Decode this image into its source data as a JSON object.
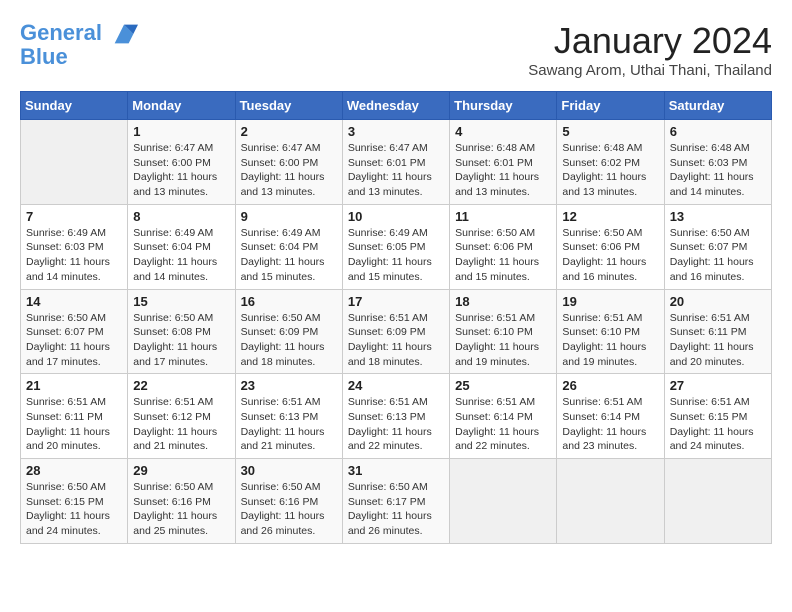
{
  "logo": {
    "line1": "General",
    "line2": "Blue"
  },
  "title": "January 2024",
  "subtitle": "Sawang Arom, Uthai Thani, Thailand",
  "days_of_week": [
    "Sunday",
    "Monday",
    "Tuesday",
    "Wednesday",
    "Thursday",
    "Friday",
    "Saturday"
  ],
  "weeks": [
    [
      {
        "day": "",
        "info": ""
      },
      {
        "day": "1",
        "info": "Sunrise: 6:47 AM\nSunset: 6:00 PM\nDaylight: 11 hours\nand 13 minutes."
      },
      {
        "day": "2",
        "info": "Sunrise: 6:47 AM\nSunset: 6:00 PM\nDaylight: 11 hours\nand 13 minutes."
      },
      {
        "day": "3",
        "info": "Sunrise: 6:47 AM\nSunset: 6:01 PM\nDaylight: 11 hours\nand 13 minutes."
      },
      {
        "day": "4",
        "info": "Sunrise: 6:48 AM\nSunset: 6:01 PM\nDaylight: 11 hours\nand 13 minutes."
      },
      {
        "day": "5",
        "info": "Sunrise: 6:48 AM\nSunset: 6:02 PM\nDaylight: 11 hours\nand 13 minutes."
      },
      {
        "day": "6",
        "info": "Sunrise: 6:48 AM\nSunset: 6:03 PM\nDaylight: 11 hours\nand 14 minutes."
      }
    ],
    [
      {
        "day": "7",
        "info": "Sunrise: 6:49 AM\nSunset: 6:03 PM\nDaylight: 11 hours\nand 14 minutes."
      },
      {
        "day": "8",
        "info": "Sunrise: 6:49 AM\nSunset: 6:04 PM\nDaylight: 11 hours\nand 14 minutes."
      },
      {
        "day": "9",
        "info": "Sunrise: 6:49 AM\nSunset: 6:04 PM\nDaylight: 11 hours\nand 15 minutes."
      },
      {
        "day": "10",
        "info": "Sunrise: 6:49 AM\nSunset: 6:05 PM\nDaylight: 11 hours\nand 15 minutes."
      },
      {
        "day": "11",
        "info": "Sunrise: 6:50 AM\nSunset: 6:06 PM\nDaylight: 11 hours\nand 15 minutes."
      },
      {
        "day": "12",
        "info": "Sunrise: 6:50 AM\nSunset: 6:06 PM\nDaylight: 11 hours\nand 16 minutes."
      },
      {
        "day": "13",
        "info": "Sunrise: 6:50 AM\nSunset: 6:07 PM\nDaylight: 11 hours\nand 16 minutes."
      }
    ],
    [
      {
        "day": "14",
        "info": "Sunrise: 6:50 AM\nSunset: 6:07 PM\nDaylight: 11 hours\nand 17 minutes."
      },
      {
        "day": "15",
        "info": "Sunrise: 6:50 AM\nSunset: 6:08 PM\nDaylight: 11 hours\nand 17 minutes."
      },
      {
        "day": "16",
        "info": "Sunrise: 6:50 AM\nSunset: 6:09 PM\nDaylight: 11 hours\nand 18 minutes."
      },
      {
        "day": "17",
        "info": "Sunrise: 6:51 AM\nSunset: 6:09 PM\nDaylight: 11 hours\nand 18 minutes."
      },
      {
        "day": "18",
        "info": "Sunrise: 6:51 AM\nSunset: 6:10 PM\nDaylight: 11 hours\nand 19 minutes."
      },
      {
        "day": "19",
        "info": "Sunrise: 6:51 AM\nSunset: 6:10 PM\nDaylight: 11 hours\nand 19 minutes."
      },
      {
        "day": "20",
        "info": "Sunrise: 6:51 AM\nSunset: 6:11 PM\nDaylight: 11 hours\nand 20 minutes."
      }
    ],
    [
      {
        "day": "21",
        "info": "Sunrise: 6:51 AM\nSunset: 6:11 PM\nDaylight: 11 hours\nand 20 minutes."
      },
      {
        "day": "22",
        "info": "Sunrise: 6:51 AM\nSunset: 6:12 PM\nDaylight: 11 hours\nand 21 minutes."
      },
      {
        "day": "23",
        "info": "Sunrise: 6:51 AM\nSunset: 6:13 PM\nDaylight: 11 hours\nand 21 minutes."
      },
      {
        "day": "24",
        "info": "Sunrise: 6:51 AM\nSunset: 6:13 PM\nDaylight: 11 hours\nand 22 minutes."
      },
      {
        "day": "25",
        "info": "Sunrise: 6:51 AM\nSunset: 6:14 PM\nDaylight: 11 hours\nand 22 minutes."
      },
      {
        "day": "26",
        "info": "Sunrise: 6:51 AM\nSunset: 6:14 PM\nDaylight: 11 hours\nand 23 minutes."
      },
      {
        "day": "27",
        "info": "Sunrise: 6:51 AM\nSunset: 6:15 PM\nDaylight: 11 hours\nand 24 minutes."
      }
    ],
    [
      {
        "day": "28",
        "info": "Sunrise: 6:50 AM\nSunset: 6:15 PM\nDaylight: 11 hours\nand 24 minutes."
      },
      {
        "day": "29",
        "info": "Sunrise: 6:50 AM\nSunset: 6:16 PM\nDaylight: 11 hours\nand 25 minutes."
      },
      {
        "day": "30",
        "info": "Sunrise: 6:50 AM\nSunset: 6:16 PM\nDaylight: 11 hours\nand 26 minutes."
      },
      {
        "day": "31",
        "info": "Sunrise: 6:50 AM\nSunset: 6:17 PM\nDaylight: 11 hours\nand 26 minutes."
      },
      {
        "day": "",
        "info": ""
      },
      {
        "day": "",
        "info": ""
      },
      {
        "day": "",
        "info": ""
      }
    ]
  ]
}
